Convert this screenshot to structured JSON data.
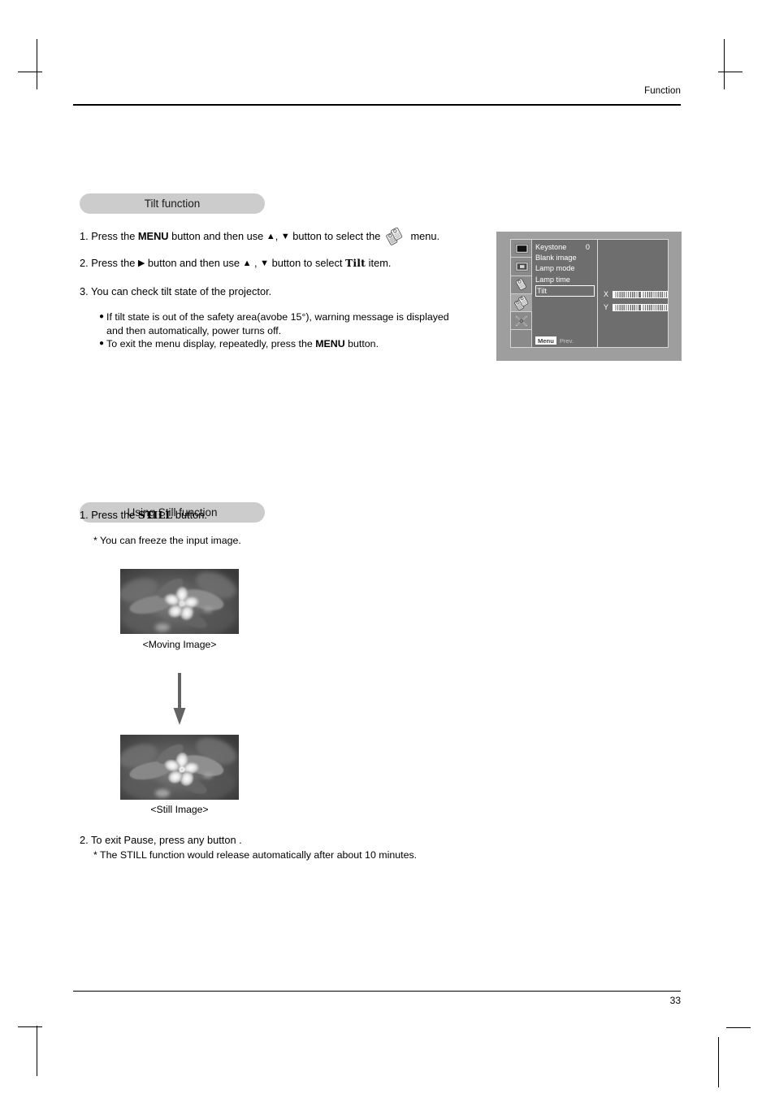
{
  "page": {
    "header": "Function",
    "number": "33"
  },
  "sections": [
    {
      "id": "tilt",
      "title": "Tilt function",
      "steps": [
        {
          "num": "1.",
          "parts": [
            {
              "t": "Press the ",
              "style": "normal"
            },
            {
              "t": "MENU",
              "style": "bold"
            },
            {
              "t": " button and then use ",
              "style": "normal"
            },
            {
              "t": "▲",
              "style": "tri"
            },
            {
              "t": ", ",
              "style": "normal"
            },
            {
              "t": "▼",
              "style": "tri"
            },
            {
              "t": " button to select the ",
              "style": "normal"
            },
            {
              "t": "",
              "style": "icon-tag"
            },
            {
              "t": " menu.",
              "style": "normal"
            }
          ]
        },
        {
          "num": "2.",
          "parts": [
            {
              "t": "Press the ",
              "style": "normal"
            },
            {
              "t": "▶",
              "style": "tri"
            },
            {
              "t": " button and then use ",
              "style": "normal"
            },
            {
              "t": "▲",
              "style": "tri"
            },
            {
              "t": " , ",
              "style": "normal"
            },
            {
              "t": "▼",
              "style": "tri"
            },
            {
              "t": " button to select ",
              "style": "normal"
            },
            {
              "t": "Tilt",
              "style": "slab"
            },
            {
              "t": " item.",
              "style": "normal"
            }
          ]
        },
        {
          "num": "3.",
          "parts": [
            {
              "t": "You can check tilt state of the projector.",
              "style": "normal"
            }
          ]
        }
      ],
      "bullets": [
        {
          "lines": [
            "If tilt state is out of  the safety area(avobe 15°), warning message is displayed",
            "and then automatically, power turns off."
          ],
          "bold_words": []
        },
        {
          "lines": [
            "To exit the menu display, repeatedly, press the MENU button."
          ],
          "bold_words": [
            "MENU"
          ]
        }
      ]
    },
    {
      "id": "still",
      "title": "Using Still function",
      "step1": {
        "num": "1.",
        "pre": "Press the ",
        "key": "STILL",
        "post": " button."
      },
      "note1": "* You can freeze the input image.",
      "caption_moving": "<Moving Image>",
      "caption_still": "<Still Image>",
      "step2": {
        "num": "2.",
        "text": "To exit Pause, press any button ."
      },
      "note2": "* The STILL function would release automatically after about 10 minutes."
    }
  ],
  "osd": {
    "menu_items": [
      {
        "label": "Keystone",
        "value": "0",
        "selected": false
      },
      {
        "label": "Blank image",
        "value": "",
        "selected": false
      },
      {
        "label": "Lamp mode",
        "value": "",
        "selected": false
      },
      {
        "label": "Lamp time",
        "value": "",
        "selected": false
      },
      {
        "label": "Tilt",
        "value": "",
        "selected": true
      }
    ],
    "sliders": [
      {
        "axis": "X"
      },
      {
        "axis": "Y"
      }
    ],
    "bottom_bar": {
      "menu_key": "Menu",
      "prev_label": "Prev."
    },
    "icons": [
      {
        "name": "screen-icon",
        "active": false
      },
      {
        "name": "picture-in-picture-icon",
        "active": false
      },
      {
        "name": "single-tag-icon",
        "active": false
      },
      {
        "name": "double-tag-icon",
        "active": true
      },
      {
        "name": "tool-icon",
        "active": false
      }
    ]
  },
  "colors": {
    "pill_bg": "#cccccc",
    "osd_bg": "#9e9e9e",
    "osd_panel": "#6e6e6e",
    "osd_iconcol": "#8a8a8a",
    "arrow": "#636363"
  }
}
